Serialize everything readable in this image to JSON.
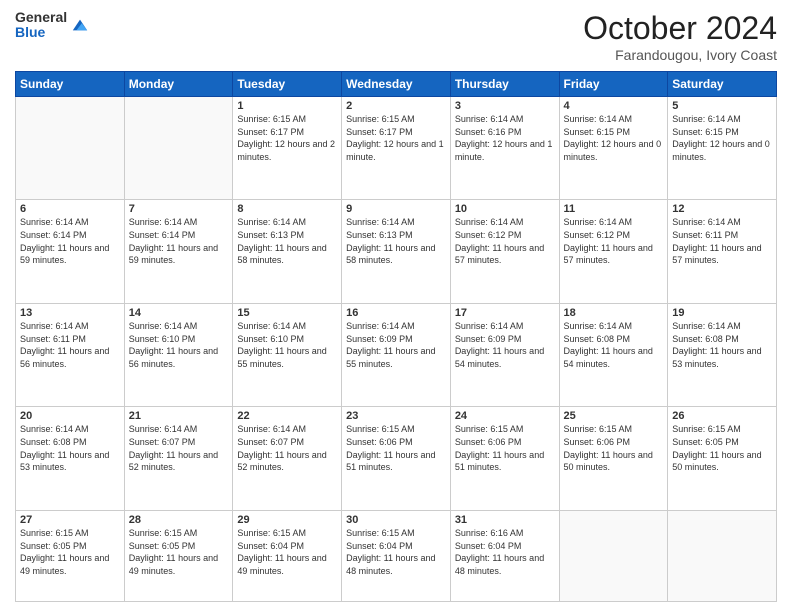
{
  "logo": {
    "general": "General",
    "blue": "Blue"
  },
  "header": {
    "month": "October 2024",
    "location": "Farandougou, Ivory Coast"
  },
  "weekdays": [
    "Sunday",
    "Monday",
    "Tuesday",
    "Wednesday",
    "Thursday",
    "Friday",
    "Saturday"
  ],
  "weeks": [
    [
      {
        "day": "",
        "sunrise": "",
        "sunset": "",
        "daylight": ""
      },
      {
        "day": "",
        "sunrise": "",
        "sunset": "",
        "daylight": ""
      },
      {
        "day": "1",
        "sunrise": "Sunrise: 6:15 AM",
        "sunset": "Sunset: 6:17 PM",
        "daylight": "Daylight: 12 hours and 2 minutes."
      },
      {
        "day": "2",
        "sunrise": "Sunrise: 6:15 AM",
        "sunset": "Sunset: 6:17 PM",
        "daylight": "Daylight: 12 hours and 1 minute."
      },
      {
        "day": "3",
        "sunrise": "Sunrise: 6:14 AM",
        "sunset": "Sunset: 6:16 PM",
        "daylight": "Daylight: 12 hours and 1 minute."
      },
      {
        "day": "4",
        "sunrise": "Sunrise: 6:14 AM",
        "sunset": "Sunset: 6:15 PM",
        "daylight": "Daylight: 12 hours and 0 minutes."
      },
      {
        "day": "5",
        "sunrise": "Sunrise: 6:14 AM",
        "sunset": "Sunset: 6:15 PM",
        "daylight": "Daylight: 12 hours and 0 minutes."
      }
    ],
    [
      {
        "day": "6",
        "sunrise": "Sunrise: 6:14 AM",
        "sunset": "Sunset: 6:14 PM",
        "daylight": "Daylight: 11 hours and 59 minutes."
      },
      {
        "day": "7",
        "sunrise": "Sunrise: 6:14 AM",
        "sunset": "Sunset: 6:14 PM",
        "daylight": "Daylight: 11 hours and 59 minutes."
      },
      {
        "day": "8",
        "sunrise": "Sunrise: 6:14 AM",
        "sunset": "Sunset: 6:13 PM",
        "daylight": "Daylight: 11 hours and 58 minutes."
      },
      {
        "day": "9",
        "sunrise": "Sunrise: 6:14 AM",
        "sunset": "Sunset: 6:13 PM",
        "daylight": "Daylight: 11 hours and 58 minutes."
      },
      {
        "day": "10",
        "sunrise": "Sunrise: 6:14 AM",
        "sunset": "Sunset: 6:12 PM",
        "daylight": "Daylight: 11 hours and 57 minutes."
      },
      {
        "day": "11",
        "sunrise": "Sunrise: 6:14 AM",
        "sunset": "Sunset: 6:12 PM",
        "daylight": "Daylight: 11 hours and 57 minutes."
      },
      {
        "day": "12",
        "sunrise": "Sunrise: 6:14 AM",
        "sunset": "Sunset: 6:11 PM",
        "daylight": "Daylight: 11 hours and 57 minutes."
      }
    ],
    [
      {
        "day": "13",
        "sunrise": "Sunrise: 6:14 AM",
        "sunset": "Sunset: 6:11 PM",
        "daylight": "Daylight: 11 hours and 56 minutes."
      },
      {
        "day": "14",
        "sunrise": "Sunrise: 6:14 AM",
        "sunset": "Sunset: 6:10 PM",
        "daylight": "Daylight: 11 hours and 56 minutes."
      },
      {
        "day": "15",
        "sunrise": "Sunrise: 6:14 AM",
        "sunset": "Sunset: 6:10 PM",
        "daylight": "Daylight: 11 hours and 55 minutes."
      },
      {
        "day": "16",
        "sunrise": "Sunrise: 6:14 AM",
        "sunset": "Sunset: 6:09 PM",
        "daylight": "Daylight: 11 hours and 55 minutes."
      },
      {
        "day": "17",
        "sunrise": "Sunrise: 6:14 AM",
        "sunset": "Sunset: 6:09 PM",
        "daylight": "Daylight: 11 hours and 54 minutes."
      },
      {
        "day": "18",
        "sunrise": "Sunrise: 6:14 AM",
        "sunset": "Sunset: 6:08 PM",
        "daylight": "Daylight: 11 hours and 54 minutes."
      },
      {
        "day": "19",
        "sunrise": "Sunrise: 6:14 AM",
        "sunset": "Sunset: 6:08 PM",
        "daylight": "Daylight: 11 hours and 53 minutes."
      }
    ],
    [
      {
        "day": "20",
        "sunrise": "Sunrise: 6:14 AM",
        "sunset": "Sunset: 6:08 PM",
        "daylight": "Daylight: 11 hours and 53 minutes."
      },
      {
        "day": "21",
        "sunrise": "Sunrise: 6:14 AM",
        "sunset": "Sunset: 6:07 PM",
        "daylight": "Daylight: 11 hours and 52 minutes."
      },
      {
        "day": "22",
        "sunrise": "Sunrise: 6:14 AM",
        "sunset": "Sunset: 6:07 PM",
        "daylight": "Daylight: 11 hours and 52 minutes."
      },
      {
        "day": "23",
        "sunrise": "Sunrise: 6:15 AM",
        "sunset": "Sunset: 6:06 PM",
        "daylight": "Daylight: 11 hours and 51 minutes."
      },
      {
        "day": "24",
        "sunrise": "Sunrise: 6:15 AM",
        "sunset": "Sunset: 6:06 PM",
        "daylight": "Daylight: 11 hours and 51 minutes."
      },
      {
        "day": "25",
        "sunrise": "Sunrise: 6:15 AM",
        "sunset": "Sunset: 6:06 PM",
        "daylight": "Daylight: 11 hours and 50 minutes."
      },
      {
        "day": "26",
        "sunrise": "Sunrise: 6:15 AM",
        "sunset": "Sunset: 6:05 PM",
        "daylight": "Daylight: 11 hours and 50 minutes."
      }
    ],
    [
      {
        "day": "27",
        "sunrise": "Sunrise: 6:15 AM",
        "sunset": "Sunset: 6:05 PM",
        "daylight": "Daylight: 11 hours and 49 minutes."
      },
      {
        "day": "28",
        "sunrise": "Sunrise: 6:15 AM",
        "sunset": "Sunset: 6:05 PM",
        "daylight": "Daylight: 11 hours and 49 minutes."
      },
      {
        "day": "29",
        "sunrise": "Sunrise: 6:15 AM",
        "sunset": "Sunset: 6:04 PM",
        "daylight": "Daylight: 11 hours and 49 minutes."
      },
      {
        "day": "30",
        "sunrise": "Sunrise: 6:15 AM",
        "sunset": "Sunset: 6:04 PM",
        "daylight": "Daylight: 11 hours and 48 minutes."
      },
      {
        "day": "31",
        "sunrise": "Sunrise: 6:16 AM",
        "sunset": "Sunset: 6:04 PM",
        "daylight": "Daylight: 11 hours and 48 minutes."
      },
      {
        "day": "",
        "sunrise": "",
        "sunset": "",
        "daylight": ""
      },
      {
        "day": "",
        "sunrise": "",
        "sunset": "",
        "daylight": ""
      }
    ]
  ]
}
